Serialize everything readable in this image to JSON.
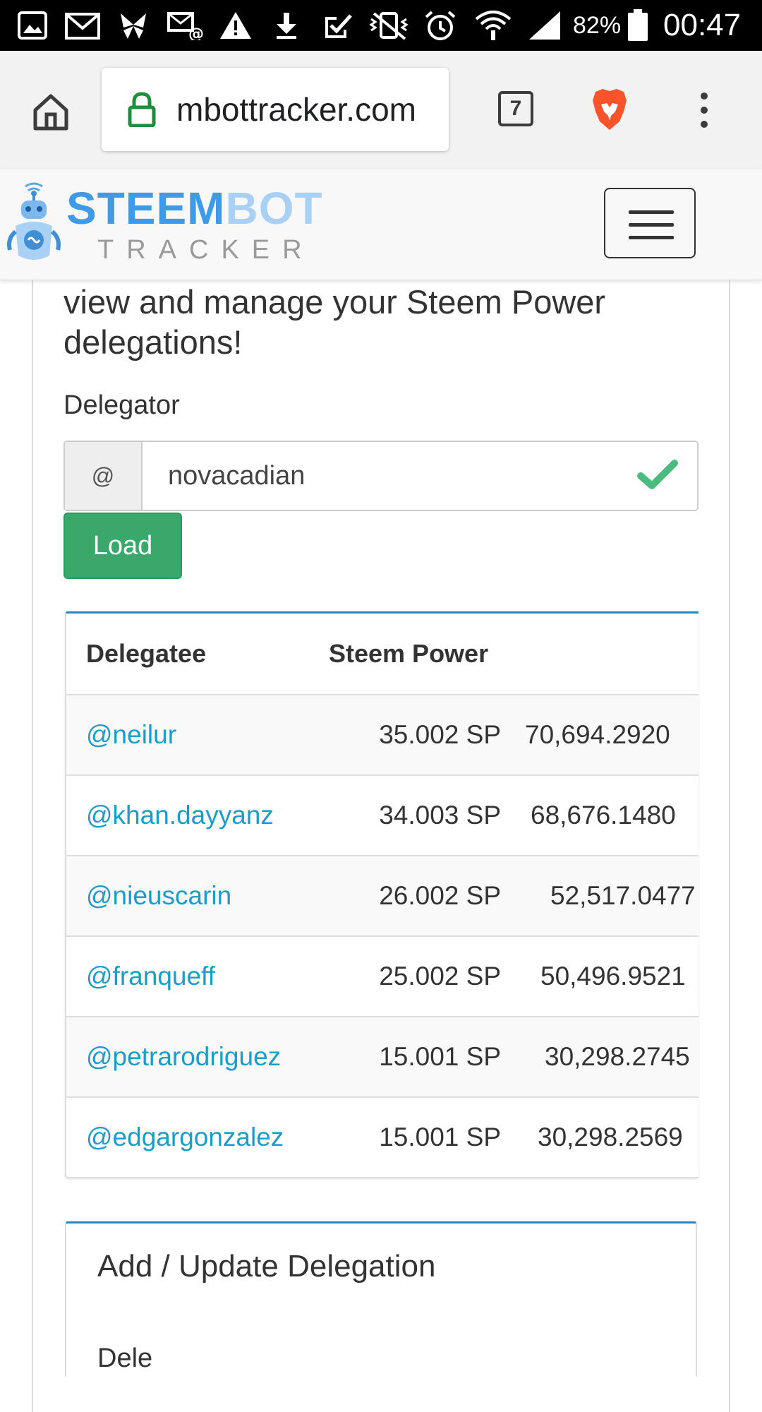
{
  "status_bar": {
    "battery_percent": "82%",
    "time": "00:47",
    "icons": [
      "gallery-icon",
      "gmail-icon",
      "butterfly-icon",
      "mail-at-icon",
      "warning-icon",
      "download-icon",
      "check-task-icon",
      "vibrate-icon",
      "alarm-icon",
      "wifi-icon",
      "signal-icon",
      "battery-icon"
    ]
  },
  "browser": {
    "url": "mbottracker.com",
    "tab_count": "7",
    "home_icon": "home-icon",
    "lock_icon": "lock-icon",
    "brave_icon": "brave-lion-icon",
    "menu_icon": "more-vert-icon"
  },
  "site": {
    "brand_steem": "STEEM",
    "brand_bot": "BOT",
    "brand_tracker": "TRACKER",
    "menu_toggle_icon": "hamburger-icon"
  },
  "page": {
    "intro": "view and manage your Steem Power delegations!",
    "delegator_label": "Delegator",
    "at_addon": "@",
    "delegator_value": "novacadian",
    "load_button": "Load"
  },
  "table": {
    "headers": [
      "Delegatee",
      "Steem Power"
    ],
    "rows": [
      {
        "name": "@neilur",
        "sp": "35.002 SP",
        "vests": "70,694.2920"
      },
      {
        "name": "@khan.dayyanz",
        "sp": "34.003 SP",
        "vests": "68,676.1480"
      },
      {
        "name": "@nieuscarin",
        "sp": "26.002 SP",
        "vests": "52,517.0477"
      },
      {
        "name": "@franqueff",
        "sp": "25.002 SP",
        "vests": "50,496.9521"
      },
      {
        "name": "@petrarodriguez",
        "sp": "15.001 SP",
        "vests": "30,298.2745"
      },
      {
        "name": "@edgargonzalez",
        "sp": "15.001 SP",
        "vests": "30,298.2569"
      }
    ]
  },
  "update_panel": {
    "title": "Add / Update Delegation",
    "next_label": "Dele"
  },
  "colors": {
    "accent_blue": "#1b8dbb",
    "link": "#1b9cc9",
    "load_green": "#3aa86b",
    "check_green": "#4cbb7f"
  }
}
